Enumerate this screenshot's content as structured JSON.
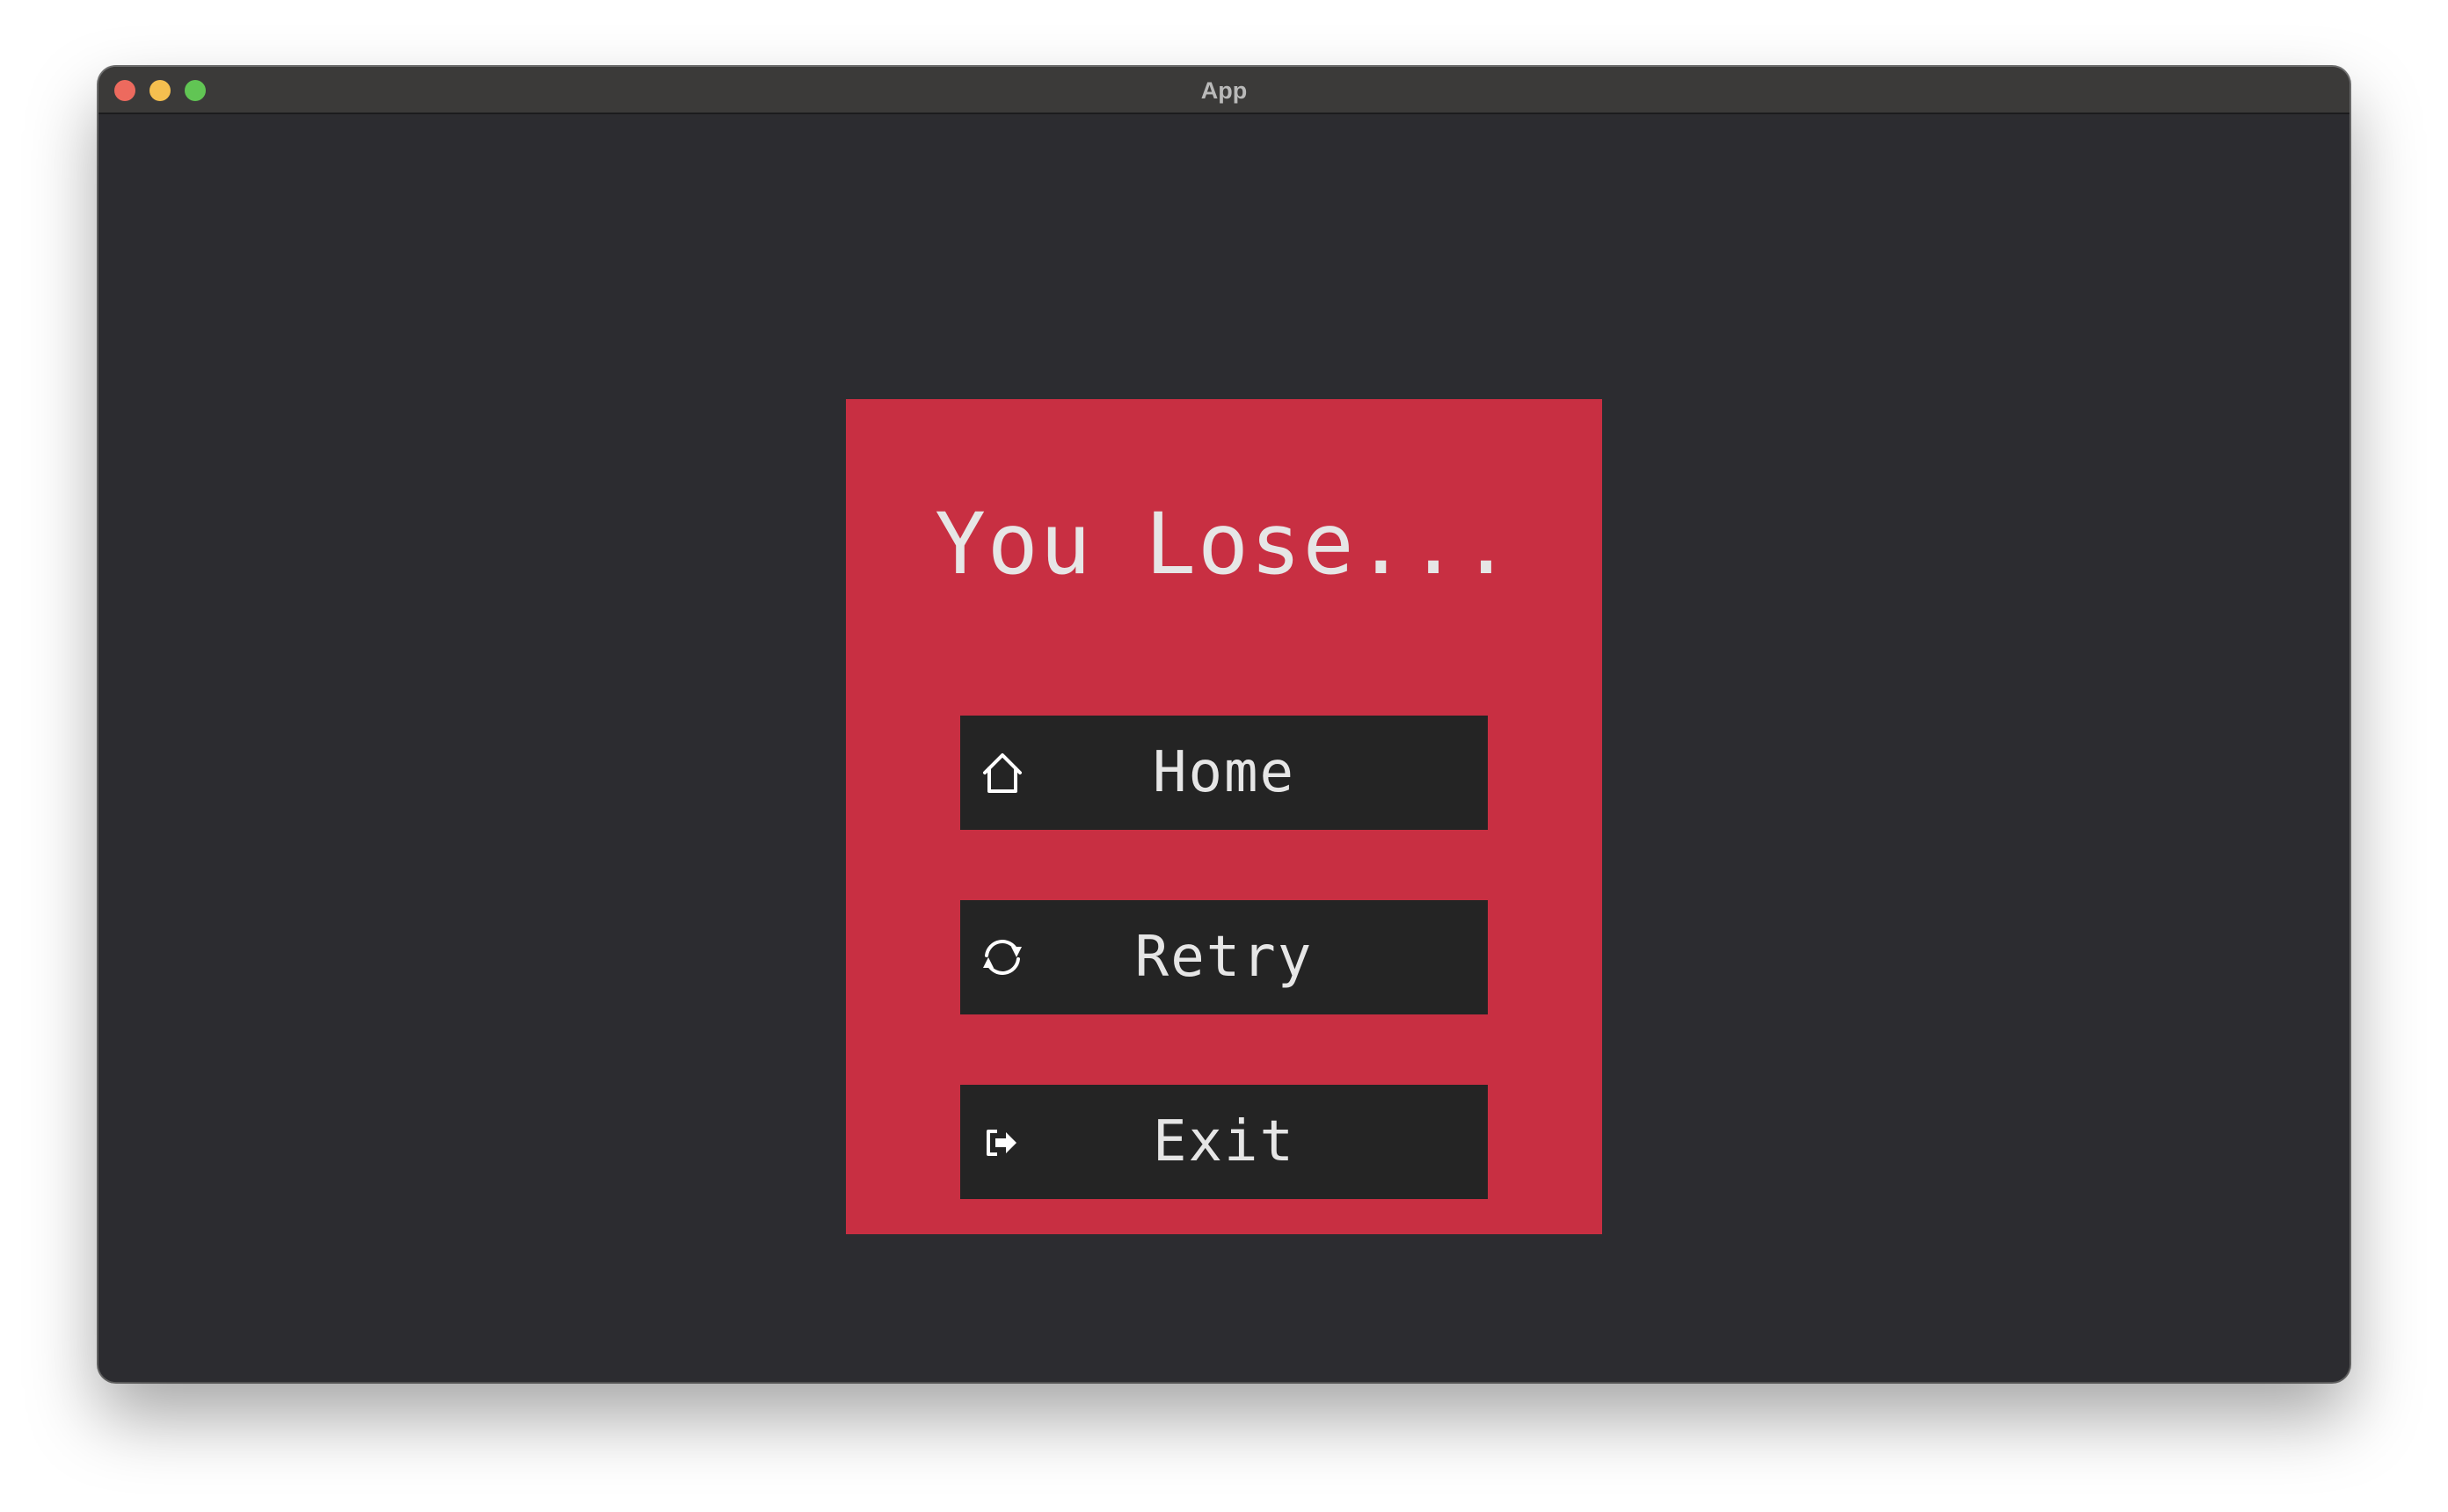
{
  "window": {
    "title": "App"
  },
  "dialog": {
    "title": "You Lose...",
    "background_color": "#c82f42",
    "buttons": [
      {
        "label": "Home",
        "icon": "home-icon"
      },
      {
        "label": "Retry",
        "icon": "refresh-icon"
      },
      {
        "label": "Exit",
        "icon": "exit-icon"
      }
    ]
  },
  "colors": {
    "window_background": "#2c2c30",
    "titlebar": "#3b3a39",
    "button_background": "#242424",
    "text": "#e6e6e6"
  }
}
